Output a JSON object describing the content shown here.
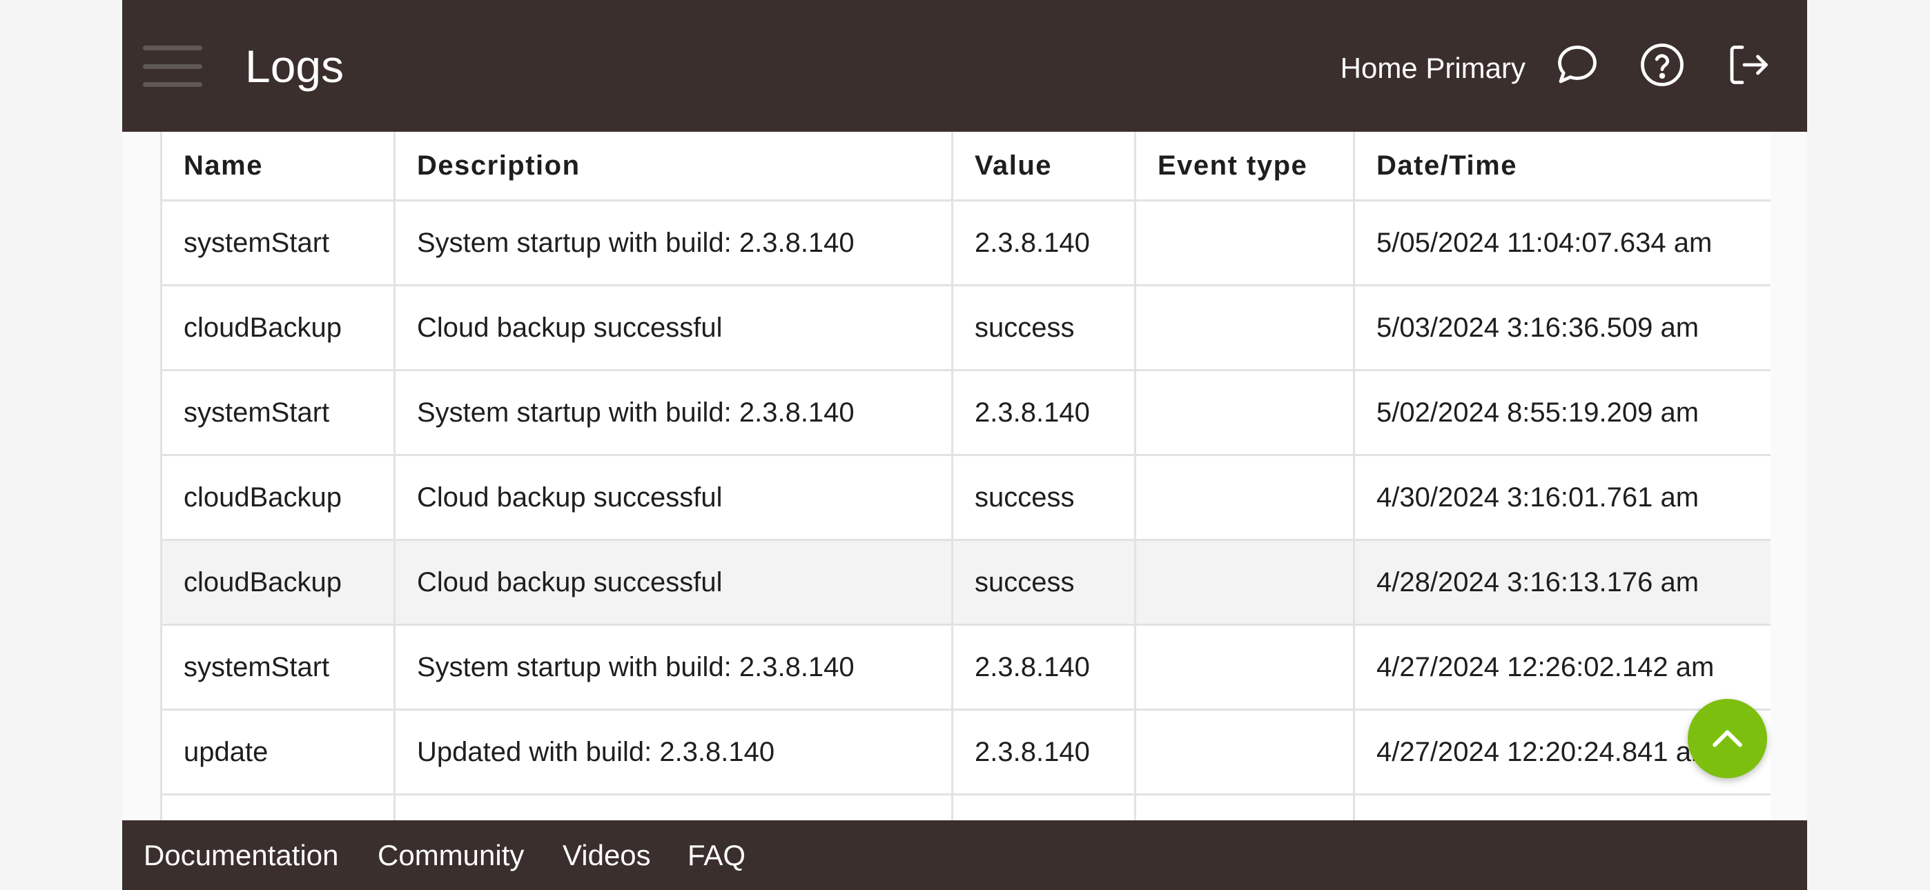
{
  "header": {
    "title": "Logs",
    "location": "Home Primary",
    "icons": [
      "menu-icon",
      "chat-bubble-icon",
      "help-circle-icon",
      "logout-icon"
    ]
  },
  "table": {
    "columns": [
      "Name",
      "Description",
      "Value",
      "Event type",
      "Date/Time"
    ],
    "rows": [
      {
        "name": "systemStart",
        "description": "System startup with build: 2.3.8.140",
        "value": "2.3.8.140",
        "event_type": "",
        "datetime": "5/05/2024 11:04:07.634 am"
      },
      {
        "name": "cloudBackup",
        "description": "Cloud backup successful",
        "value": "success",
        "event_type": "",
        "datetime": "5/03/2024 3:16:36.509 am"
      },
      {
        "name": "systemStart",
        "description": "System startup with build: 2.3.8.140",
        "value": "2.3.8.140",
        "event_type": "",
        "datetime": "5/02/2024 8:55:19.209 am"
      },
      {
        "name": "cloudBackup",
        "description": "Cloud backup successful",
        "value": "success",
        "event_type": "",
        "datetime": "4/30/2024 3:16:01.761 am"
      },
      {
        "name": "cloudBackup",
        "description": "Cloud backup successful",
        "value": "success",
        "event_type": "",
        "datetime": "4/28/2024 3:16:13.176 am"
      },
      {
        "name": "systemStart",
        "description": "System startup with build: 2.3.8.140",
        "value": "2.3.8.140",
        "event_type": "",
        "datetime": "4/27/2024 12:26:02.142 am"
      },
      {
        "name": "update",
        "description": "Updated with build: 2.3.8.140",
        "value": "2.3.8.140",
        "event_type": "",
        "datetime": "4/27/2024 12:20:24.841 am"
      },
      {
        "name": "",
        "description": "",
        "value": "",
        "event_type": "",
        "datetime": ""
      }
    ]
  },
  "footer": {
    "links": [
      "Documentation",
      "Community",
      "Videos",
      "FAQ"
    ]
  },
  "scroll_top": {
    "icon": "chevron-up-icon"
  },
  "colors": {
    "header_bg": "#3b2f2d",
    "accent": "#7cbf0f",
    "row_highlight": "#f3f3f3"
  }
}
